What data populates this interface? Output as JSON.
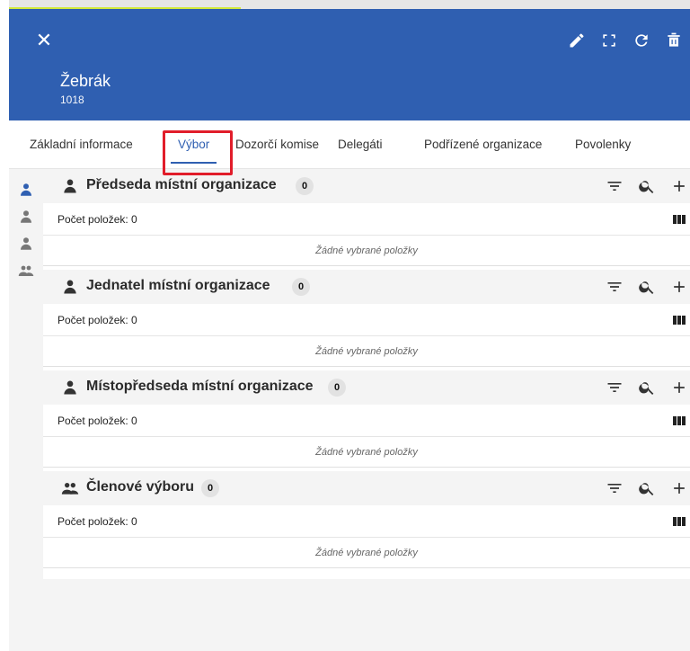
{
  "header": {
    "title": "Žebrák",
    "code": "1018",
    "tools": [
      "edit-icon",
      "fullscreen-icon",
      "refresh-icon",
      "delete-icon"
    ]
  },
  "tabs": [
    {
      "label": "Základní informace",
      "active": false
    },
    {
      "label": "Výbor",
      "active": true
    },
    {
      "label": "Dozorčí komise",
      "active": false
    },
    {
      "label": "Delegáti",
      "active": false
    },
    {
      "label": "Podřízené organizace",
      "active": false
    },
    {
      "label": "Povolenky",
      "active": false
    }
  ],
  "colors": {
    "header": "#2f5fb1",
    "accent": "#2f5fb1",
    "highlight": "#e11d2a",
    "progress": "#d4ea3c"
  },
  "sections": [
    {
      "title": "Předseda místní organizace",
      "badge": "0",
      "icon": "person-icon",
      "count": "Počet položek: 0",
      "empty": "Žádné vybrané položky"
    },
    {
      "title": "Jednatel místní organizace",
      "badge": "0",
      "icon": "person-icon",
      "count": "Počet položek: 0",
      "empty": "Žádné vybrané položky"
    },
    {
      "title": "Místopředseda místní organizace",
      "badge": "0",
      "icon": "person-icon",
      "count": "Počet položek: 0",
      "empty": "Žádné vybrané položky"
    },
    {
      "title": "Členové výboru",
      "badge": "0",
      "icon": "group-icon",
      "count": "Počet položek: 0",
      "empty": "Žádné vybrané položky"
    }
  ]
}
